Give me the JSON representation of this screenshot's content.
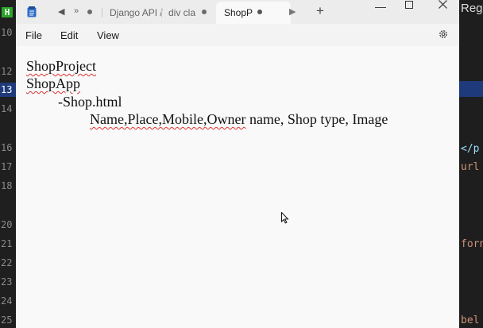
{
  "gutter": {
    "badge": "H",
    "line_numbers": [
      "10",
      "12",
      "13",
      "14",
      "16",
      "17",
      "18",
      "20",
      "21",
      "22",
      "23",
      "24",
      "25"
    ]
  },
  "right_editor": {
    "top_text": "Reg",
    "fragments": [
      "</p",
      "url",
      "forn",
      "bel"
    ]
  },
  "tabs": {
    "items": [
      "Django API /",
      "div cla"
    ],
    "active": "ShopP",
    "overflow": "»"
  },
  "menu": {
    "file": "File",
    "edit": "Edit",
    "view": "View"
  },
  "document": {
    "line1": "ShopProject",
    "line2": "ShopApp",
    "line3": "-Shop.html",
    "line4_squiggled": "Name,Place,Mobile,Owner",
    "line4_rest": " name, Shop type, Image"
  },
  "colors": {
    "accent": "#1f3a7a",
    "badge_green": "#2aa52a",
    "spell_error": "#d33333"
  }
}
